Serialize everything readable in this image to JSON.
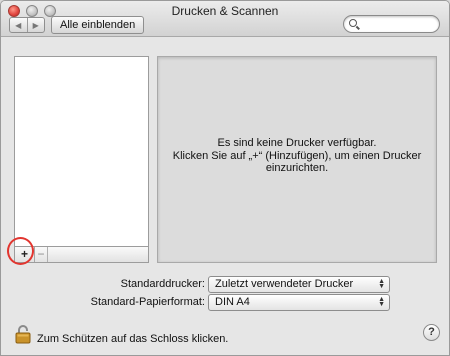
{
  "window": {
    "title": "Drucken & Scannen"
  },
  "toolbar": {
    "back_icon": "◀",
    "forward_icon": "▶",
    "show_all_label": "Alle einblenden",
    "search_placeholder": ""
  },
  "printer_list": {
    "add_label": "+",
    "remove_label": "−",
    "items": []
  },
  "info_panel": {
    "line1": "Es sind keine Drucker verfügbar.",
    "line2": "Klicken Sie auf „+“ (Hinzufügen), um einen Drucker",
    "line3": "einzurichten."
  },
  "defaults": {
    "printer_label": "Standarddrucker:",
    "printer_value": "Zuletzt verwendeter Drucker",
    "paper_label": "Standard-Papierformat:",
    "paper_value": "DIN A4"
  },
  "footer": {
    "lock_text": "Zum Schützen auf das Schloss klicken.",
    "help_label": "?"
  },
  "colors": {
    "highlight_ring": "#e2352f",
    "lock_gold": "#c9922a"
  }
}
